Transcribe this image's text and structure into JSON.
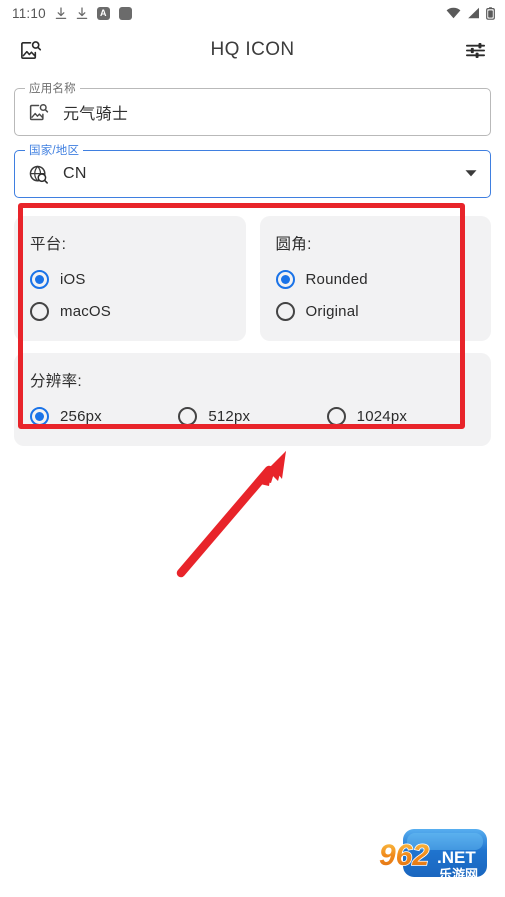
{
  "statusbar": {
    "time": "11:10",
    "left_icons": [
      "download-icon",
      "download-icon",
      "app-badge-icon",
      "app-square-icon"
    ],
    "app_badge_letter": "A",
    "right_icons": [
      "wifi-icon",
      "cellular-signal-icon",
      "battery-icon"
    ]
  },
  "appbar": {
    "title": "HQ ICON",
    "left_icon": "image-search-icon",
    "right_icon": "tune-settings-icon"
  },
  "fields": [
    {
      "label": "应用名称",
      "value": "元气骑士",
      "icon": "image-search-icon",
      "focused": false,
      "has_dropdown": false
    },
    {
      "label": "国家/地区",
      "value": "CN",
      "icon": "globe-search-icon",
      "focused": true,
      "has_dropdown": true
    }
  ],
  "cards": {
    "platform": {
      "title": "平台:",
      "options": [
        {
          "label": "iOS",
          "selected": true
        },
        {
          "label": "macOS",
          "selected": false
        }
      ]
    },
    "corner": {
      "title": "圆角:",
      "options": [
        {
          "label": "Rounded",
          "selected": true
        },
        {
          "label": "Original",
          "selected": false
        }
      ]
    },
    "resolution": {
      "title": "分辨率:",
      "options": [
        {
          "label": "256px",
          "selected": true
        },
        {
          "label": "512px",
          "selected": false
        },
        {
          "label": "1024px",
          "selected": false
        }
      ]
    }
  },
  "annotations": {
    "highlight_color": "#e8242a",
    "arrow_color": "#e8242a",
    "box_label": "options-highlight",
    "arrow_label": "pointer-arrow"
  },
  "watermark": {
    "number_text": "962",
    "dot_net_text": ".NET",
    "cn_text": "乐游网",
    "number_color": "#f0901e",
    "net_color": "#ffffff",
    "panel_color": "#2b7fd4"
  },
  "colors": {
    "accent_blue": "#1a73e8",
    "focus_border": "#3f7fe0",
    "card_bg": "#f2f2f3",
    "page_bg": "#ffffff",
    "text_primary": "#2e2e2e"
  }
}
